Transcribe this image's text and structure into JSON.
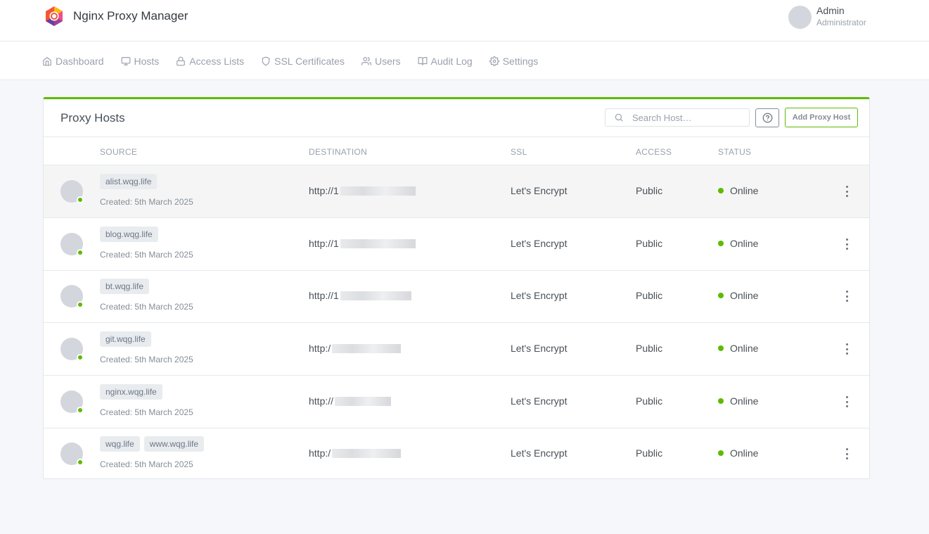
{
  "app": {
    "title": "Nginx Proxy Manager"
  },
  "user": {
    "name": "Admin",
    "role": "Administrator"
  },
  "nav": [
    {
      "label": "Dashboard",
      "icon": "home-icon"
    },
    {
      "label": "Hosts",
      "icon": "monitor-icon"
    },
    {
      "label": "Access Lists",
      "icon": "lock-icon"
    },
    {
      "label": "SSL Certificates",
      "icon": "shield-icon"
    },
    {
      "label": "Users",
      "icon": "users-icon"
    },
    {
      "label": "Audit Log",
      "icon": "book-icon"
    },
    {
      "label": "Settings",
      "icon": "gear-icon"
    }
  ],
  "card": {
    "title": "Proxy Hosts",
    "search_placeholder": "Search Host…",
    "add_button": "Add Proxy Host",
    "accent_color": "#5eba00"
  },
  "table": {
    "columns": [
      "SOURCE",
      "DESTINATION",
      "SSL",
      "ACCESS",
      "STATUS"
    ],
    "rows": [
      {
        "domains": [
          "alist.wqg.life"
        ],
        "created": "Created: 5th March 2025",
        "destination": "http://1",
        "ssl": "Let's Encrypt",
        "access": "Public",
        "status": "Online"
      },
      {
        "domains": [
          "blog.wqg.life"
        ],
        "created": "Created: 5th March 2025",
        "destination": "http://1",
        "ssl": "Let's Encrypt",
        "access": "Public",
        "status": "Online"
      },
      {
        "domains": [
          "bt.wqg.life"
        ],
        "created": "Created: 5th March 2025",
        "destination": "http://1",
        "ssl": "Let's Encrypt",
        "access": "Public",
        "status": "Online"
      },
      {
        "domains": [
          "git.wqg.life"
        ],
        "created": "Created: 5th March 2025",
        "destination": "http:/",
        "ssl": "Let's Encrypt",
        "access": "Public",
        "status": "Online"
      },
      {
        "domains": [
          "nginx.wqg.life"
        ],
        "created": "Created: 5th March 2025",
        "destination": "http://",
        "ssl": "Let's Encrypt",
        "access": "Public",
        "status": "Online"
      },
      {
        "domains": [
          "wqg.life",
          "www.wqg.life"
        ],
        "created": "Created: 5th March 2025",
        "destination": "http:/",
        "ssl": "Let's Encrypt",
        "access": "Public",
        "status": "Online"
      }
    ]
  }
}
